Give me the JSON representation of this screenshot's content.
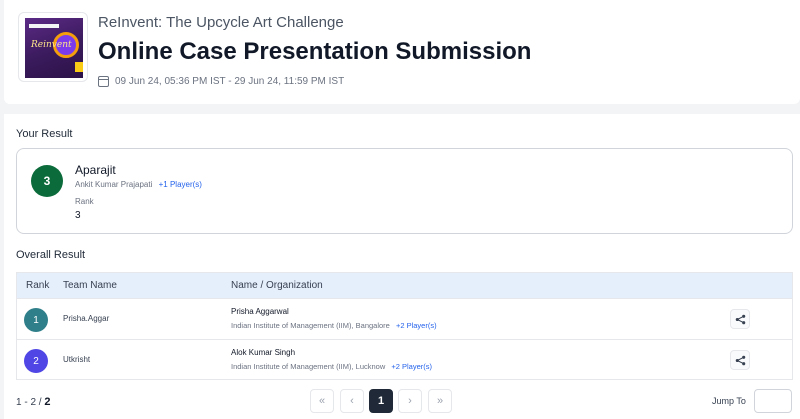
{
  "event": {
    "subtitle": "ReInvent: The Upcycle Art Challenge",
    "title": "Online Case Presentation Submission",
    "dates": "09 Jun 24, 05:36 PM IST - 29 Jun 24, 11:59 PM IST",
    "thumb_text": "Reinvent"
  },
  "your_result": {
    "heading": "Your Result",
    "rank_badge": "3",
    "team_name": "Aparajit",
    "members": "Ankit Kumar Prajapati",
    "extra_players": "+1 Player(s)",
    "rank_label": "Rank",
    "rank_value": "3"
  },
  "overall": {
    "heading": "Overall Result",
    "columns": [
      "Rank",
      "Team Name",
      "Name / Organization"
    ],
    "rows": [
      {
        "rank": "1",
        "team": "Prisha.Aggar",
        "person": "Prisha Aggarwal",
        "org": "Indian Institute of Management (IIM), Bangalore",
        "extra": "+2 Player(s)",
        "color": "#2f7f8a"
      },
      {
        "rank": "2",
        "team": "Utkrisht",
        "person": "Alok Kumar Singh",
        "org": "Indian Institute of Management (IIM), Lucknow",
        "extra": "+2 Player(s)",
        "color": "#4f46e5"
      }
    ]
  },
  "pagination": {
    "range": "1 - 2 /",
    "total": "2",
    "first": "«",
    "prev": "‹",
    "current": "1",
    "next": "›",
    "last": "»",
    "jump_label": "Jump To",
    "jump_value": ""
  },
  "colors": {
    "rank_badge": "#0b6b3a",
    "link": "#2563eb",
    "header_row": "#e5eefb"
  }
}
